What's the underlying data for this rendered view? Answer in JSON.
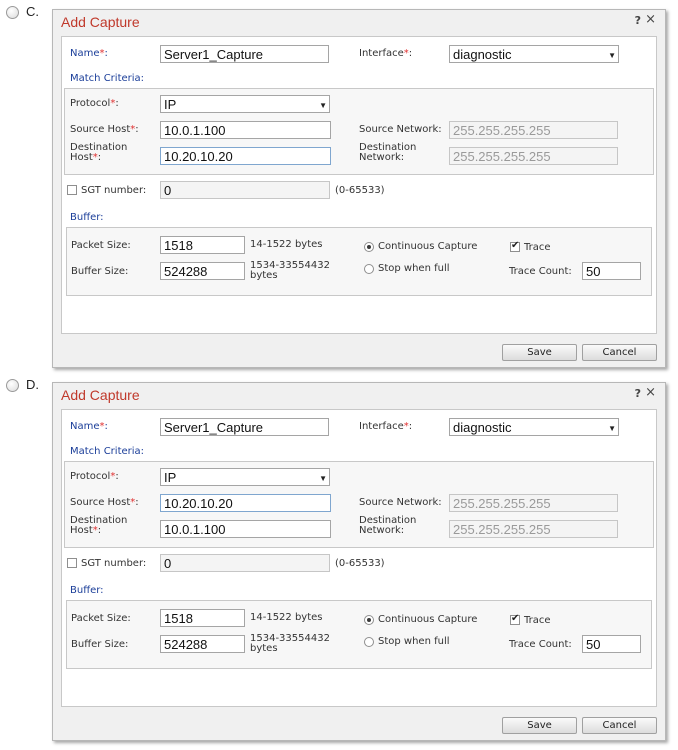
{
  "dialog_common": {
    "title": "Add Capture",
    "help_glyph": "?",
    "close_glyph": "×",
    "name_label": "Name",
    "required_mark": "*",
    "colon": ":",
    "interface_label": "Interface",
    "match_criteria_title": "Match Criteria:",
    "protocol_label": "Protocol",
    "source_host_label": "Source Host",
    "destination_label_line1": "Destination",
    "destination_label_line2": "Host",
    "source_network_label": "Source Network:",
    "destination_network_line1": "Destination",
    "destination_network_line2": "Network:",
    "sgt_label": "SGT number:",
    "sgt_range": "(0-65533)",
    "buffer_title": "Buffer:",
    "packet_size_label": "Packet Size:",
    "packet_size_range": "14-1522 bytes",
    "buffer_size_label": "Buffer Size:",
    "buffer_size_range_line1": "1534-33554432",
    "buffer_size_range_line2": "bytes",
    "continuous_capture_label": "Continuous Capture",
    "stop_when_full_label": "Stop when full",
    "trace_label": "Trace",
    "trace_count_label": "Trace Count:",
    "save_label": "Save",
    "cancel_label": "Cancel",
    "dropdown_arrow": "▼"
  },
  "options": [
    {
      "letter": "C.",
      "name_value": "Server1_Capture",
      "interface_value": "diagnostic",
      "protocol_value": "IP",
      "source_host_value": "10.0.1.100",
      "source_network_placeholder": "255.255.255.255",
      "destination_host_value": "10.20.10.20",
      "destination_network_placeholder": "255.255.255.255",
      "sgt_value": "0",
      "packet_size_value": "1518",
      "buffer_size_value": "524288",
      "trace_count_value": "50"
    },
    {
      "letter": "D.",
      "name_value": "Server1_Capture",
      "interface_value": "diagnostic",
      "protocol_value": "IP",
      "source_host_value": "10.20.10.20",
      "source_network_placeholder": "255.255.255.255",
      "destination_host_value": "10.0.1.100",
      "destination_network_placeholder": "255.255.255.255",
      "sgt_value": "0",
      "packet_size_value": "1518",
      "buffer_size_value": "524288",
      "trace_count_value": "50"
    }
  ]
}
